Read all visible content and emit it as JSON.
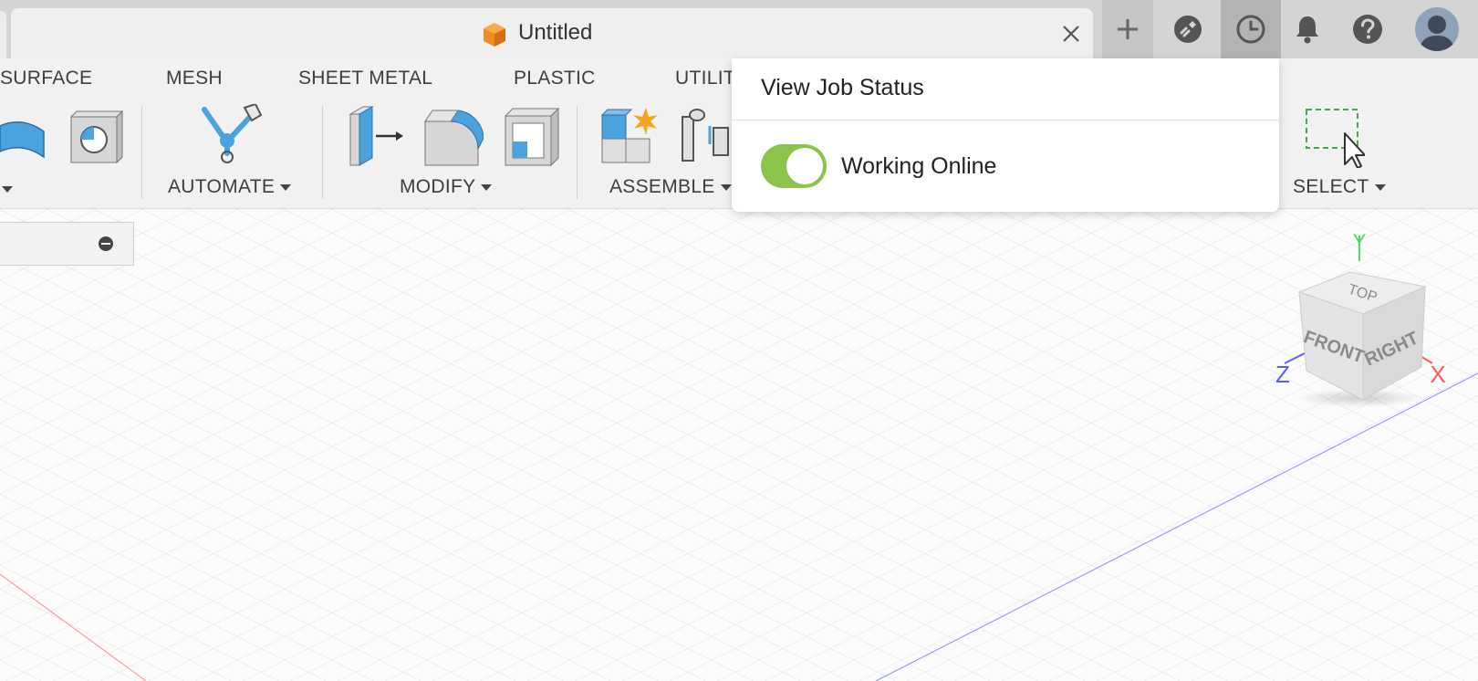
{
  "document": {
    "title": "Untitled"
  },
  "header": {
    "icons": [
      "plus-icon",
      "offline-icon",
      "job-status-clock-icon",
      "bell-icon",
      "help-icon",
      "user-avatar"
    ]
  },
  "ribbon": {
    "tabs": [
      "SURFACE",
      "MESH",
      "SHEET METAL",
      "PLASTIC",
      "UTILITIES"
    ],
    "groups": {
      "automate": "AUTOMATE",
      "modify": "MODIFY",
      "assemble": "ASSEMBLE",
      "select": "SELECT"
    }
  },
  "popup": {
    "title": "View Job Status",
    "toggle_label": "Working Online",
    "toggle_on": true
  },
  "viewcube": {
    "faces": {
      "top": "TOP",
      "front": "FRONT",
      "right": "RIGHT"
    },
    "axes": {
      "x": "X",
      "y": "Y",
      "z": "Z"
    }
  },
  "colors": {
    "toggle_on": "#8cc34b",
    "axis_x": "#ff5a5a",
    "axis_y": "#4cd964",
    "axis_z": "#5b5bff",
    "icon_blue": "#4aa3df",
    "document_icon": "#f08a24"
  }
}
